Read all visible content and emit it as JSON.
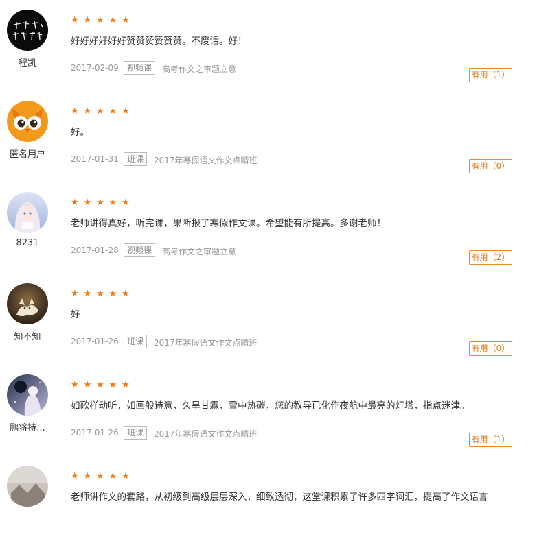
{
  "reviews": [
    {
      "username": "程凯",
      "rating": 5,
      "comment": "好好好好好好赞赞赞赞赞赞。不废话。好！",
      "date": "2017-02-09",
      "type": "视频课",
      "course": "高考作文之审题立意",
      "helpful": "有用（1）",
      "avatar": "calligraphy-avatar"
    },
    {
      "username": "匿名用户",
      "rating": 5,
      "comment": "好。",
      "date": "2017-01-31",
      "type": "班课",
      "course": "2017年寒假语文作文点睛班",
      "helpful": "有用（0）",
      "avatar": "owl-avatar"
    },
    {
      "username": "8231",
      "rating": 5,
      "comment": "老师讲得真好，听完课，果断报了寒假作文课。希望能有所提高。多谢老师！",
      "date": "2017-01-28",
      "type": "视频课",
      "course": "高考作文之审题立意",
      "helpful": "有用（2）",
      "avatar": "anime-girl-avatar"
    },
    {
      "username": "知不知",
      "rating": 5,
      "comment": "好",
      "date": "2017-01-26",
      "type": "班课",
      "course": "2017年寒假语文作文点睛班",
      "helpful": "有用（0）",
      "avatar": "fox-avatar"
    },
    {
      "username": "鹏将持...",
      "rating": 5,
      "comment": "如歌样动听，如画般诗意，久旱甘霖，雪中热碳，您的教导已化作夜航中最亮的灯塔，指点迷津。",
      "date": "2017-01-26",
      "type": "班课",
      "course": "2017年寒假语文作文点睛班",
      "helpful": "有用（1）",
      "avatar": "night-sky-avatar"
    },
    {
      "username": "",
      "rating": 5,
      "comment": "老师讲作文的套路，从初级到高级层层深入，细致透彻，这堂课积累了许多四字词汇，提高了作文语言",
      "date": "",
      "type": "",
      "course": "",
      "helpful": "",
      "avatar": "photo-avatar"
    }
  ]
}
